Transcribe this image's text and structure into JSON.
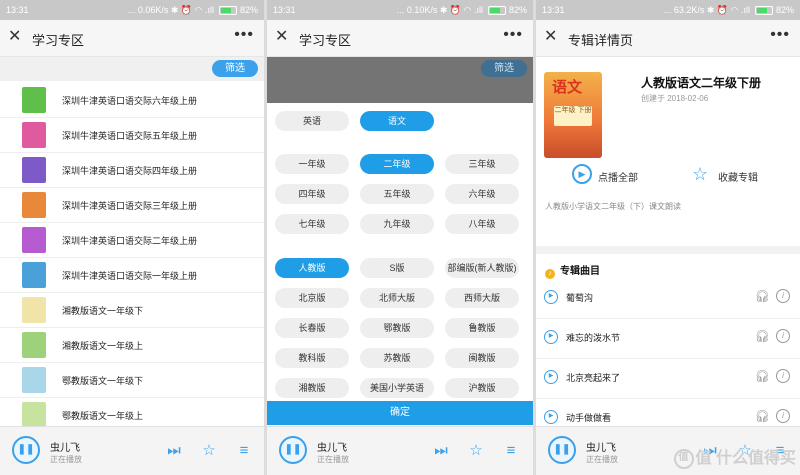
{
  "panels": [
    {
      "status": {
        "time": "13:31",
        "speed": "... 0.06K/s",
        "battery": "82%"
      },
      "title": "学习专区",
      "filter_label": "筛选",
      "items": [
        {
          "label": "深圳牛津英语口语交际六年级上册",
          "color": "#5fbf4a"
        },
        {
          "label": "深圳牛津英语口语交际五年级上册",
          "color": "#e05aa0"
        },
        {
          "label": "深圳牛津英语口语交际四年级上册",
          "color": "#7e5ac9"
        },
        {
          "label": "深圳牛津英语口语交际三年级上册",
          "color": "#e8883a"
        },
        {
          "label": "深圳牛津英语口语交际二年级上册",
          "color": "#b65bd0"
        },
        {
          "label": "深圳牛津英语口语交际一年级上册",
          "color": "#4aa0d8"
        },
        {
          "label": "湘教版语文一年级下",
          "color": "#f0e4a8"
        },
        {
          "label": "湘教版语文一年级上",
          "color": "#9ed27a"
        },
        {
          "label": "鄂教版语文一年级下",
          "color": "#a9d6e8"
        },
        {
          "label": "鄂教版语文一年级上",
          "color": "#c6e4a0"
        }
      ]
    },
    {
      "status": {
        "time": "13:31",
        "speed": "... 0.10K/s",
        "battery": "82%"
      },
      "title": "学习专区",
      "filter_label": "筛选",
      "subjects": [
        {
          "label": "英语",
          "selected": false
        },
        {
          "label": "语文",
          "selected": true
        }
      ],
      "grades": [
        {
          "label": "一年级",
          "selected": false
        },
        {
          "label": "二年级",
          "selected": true
        },
        {
          "label": "三年级",
          "selected": false
        },
        {
          "label": "四年级",
          "selected": false
        },
        {
          "label": "五年级",
          "selected": false
        },
        {
          "label": "六年级",
          "selected": false
        },
        {
          "label": "七年级",
          "selected": false
        },
        {
          "label": "九年级",
          "selected": false
        },
        {
          "label": "八年级",
          "selected": false
        }
      ],
      "editions": [
        {
          "label": "人教版",
          "selected": true
        },
        {
          "label": "S版",
          "selected": false
        },
        {
          "label": "部编版(新人教版)",
          "selected": false
        },
        {
          "label": "北京版",
          "selected": false
        },
        {
          "label": "北师大版",
          "selected": false
        },
        {
          "label": "西师大版",
          "selected": false
        },
        {
          "label": "长春版",
          "selected": false
        },
        {
          "label": "鄂教版",
          "selected": false
        },
        {
          "label": "鲁教版",
          "selected": false
        },
        {
          "label": "教科版",
          "selected": false
        },
        {
          "label": "苏教版",
          "selected": false
        },
        {
          "label": "闽教版",
          "selected": false
        },
        {
          "label": "湘教版",
          "selected": false
        },
        {
          "label": "美国小学英语",
          "selected": false
        },
        {
          "label": "沪教版",
          "selected": false
        }
      ],
      "confirm_label": "确定"
    },
    {
      "status": {
        "time": "13:31",
        "speed": "... 63.2K/s",
        "battery": "82%"
      },
      "title": "专辑详情页",
      "album": {
        "cover_title": "语文",
        "cover_grade": "二年级 下册",
        "title": "人教版语文二年级下册",
        "created": "创建于 2018-02-06",
        "play_all": "点播全部",
        "favorite": "收藏专辑",
        "description": "人教版小学语文二年级（下）课文朗读",
        "section_title": "专辑曲目",
        "tracks": [
          "葡萄沟",
          "难忘的泼水节",
          "北京亮起来了",
          "动手做做看"
        ]
      }
    }
  ],
  "player": {
    "title": "虫儿飞",
    "status": "正在播放"
  },
  "watermark": "值 什么值得买",
  "colors": {
    "accent": "#1f9de6",
    "statusbar": "#c8c8c8"
  }
}
